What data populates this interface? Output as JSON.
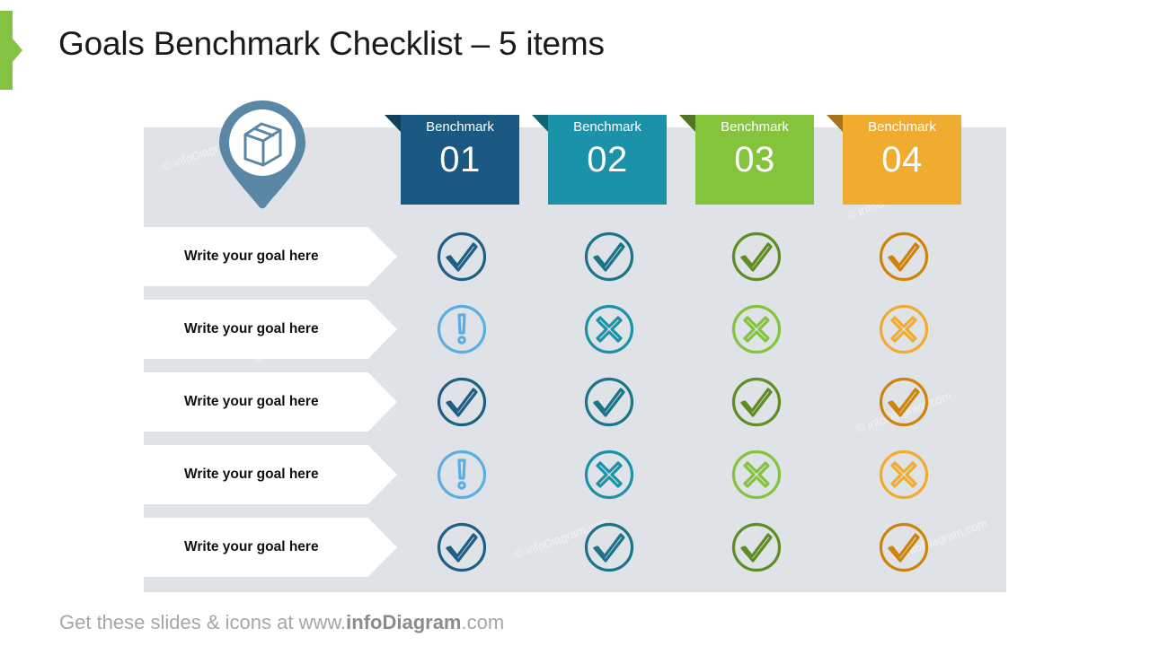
{
  "slide": {
    "title": "Goals Benchmark Checklist – 5 items",
    "accent_color": "#82C341",
    "panel_color": "#DFE2E7",
    "background": "#FFFFFF",
    "watermark_text": "© infoDiagram.com"
  },
  "marker": {
    "icon": "box-cube-icon",
    "color": "#5B87A6"
  },
  "benchmarks": [
    {
      "label": "Benchmark",
      "number": "01",
      "color": "#1A5A82",
      "fold_color": "#123F5C"
    },
    {
      "label": "Benchmark",
      "number": "02",
      "color": "#1B92A8",
      "fold_color": "#126473"
    },
    {
      "label": "Benchmark",
      "number": "03",
      "color": "#84C43C",
      "fold_color": "#4F7724"
    },
    {
      "label": "Benchmark",
      "number": "04",
      "color": "#EFAC2E",
      "fold_color": "#A8731A"
    }
  ],
  "goals": [
    {
      "label": "Write your goal here"
    },
    {
      "label": "Write your goal here"
    },
    {
      "label": "Write your goal here"
    },
    {
      "label": "Write your goal here"
    },
    {
      "label": "Write your goal here"
    }
  ],
  "status_matrix": [
    [
      {
        "icon": "check-circle-icon",
        "color": "#1E5F86"
      },
      {
        "icon": "check-circle-icon",
        "color": "#1B7489"
      },
      {
        "icon": "check-circle-icon",
        "color": "#5E8E22"
      },
      {
        "icon": "check-circle-icon",
        "color": "#CE8408"
      }
    ],
    [
      {
        "icon": "exclamation-circle-icon",
        "color": "#5BAEE4"
      },
      {
        "icon": "cross-circle-icon",
        "color": "#1B92A8"
      },
      {
        "icon": "cross-circle-icon",
        "color": "#84C43C"
      },
      {
        "icon": "cross-circle-icon",
        "color": "#EFAC2E"
      }
    ],
    [
      {
        "icon": "check-circle-icon",
        "color": "#1E5F86"
      },
      {
        "icon": "check-circle-icon",
        "color": "#1B7489"
      },
      {
        "icon": "check-circle-icon",
        "color": "#5E8E22"
      },
      {
        "icon": "check-circle-icon",
        "color": "#CE8408"
      }
    ],
    [
      {
        "icon": "exclamation-circle-icon",
        "color": "#5BAEE4"
      },
      {
        "icon": "cross-circle-icon",
        "color": "#1B92A8"
      },
      {
        "icon": "cross-circle-icon",
        "color": "#84C43C"
      },
      {
        "icon": "cross-circle-icon",
        "color": "#EFAC2E"
      }
    ],
    [
      {
        "icon": "check-circle-icon",
        "color": "#1E5F86"
      },
      {
        "icon": "check-circle-icon",
        "color": "#1B7489"
      },
      {
        "icon": "check-circle-icon",
        "color": "#5E8E22"
      },
      {
        "icon": "check-circle-icon",
        "color": "#CE8408"
      }
    ]
  ],
  "footer": {
    "prefix": "Get these slides & icons at www.",
    "brand": "infoDiagram",
    "suffix": ".com"
  }
}
